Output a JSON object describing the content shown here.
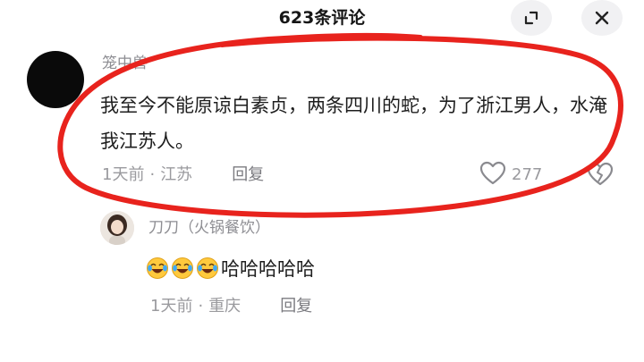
{
  "header": {
    "title": "623条评论"
  },
  "comments": [
    {
      "username": "笼中兽",
      "text": "我至今不能原谅白素贞，两条四川的蛇，为了浙江男人，水淹我江苏人。",
      "time": "1天前",
      "location": "江苏",
      "reply_label": "回复",
      "like_count": "277"
    }
  ],
  "replies": [
    {
      "username": "刀刀（火锅餐饮）",
      "emojis": [
        "laughing-crying-emoji",
        "laughing-crying-emoji",
        "laughing-crying-emoji"
      ],
      "text": "哈哈哈哈哈",
      "time": "1天前",
      "location": "重庆",
      "reply_label": "回复"
    }
  ],
  "colors": {
    "annotation_circle": "#e8231d",
    "secondary_text": "#9a9a9e"
  }
}
